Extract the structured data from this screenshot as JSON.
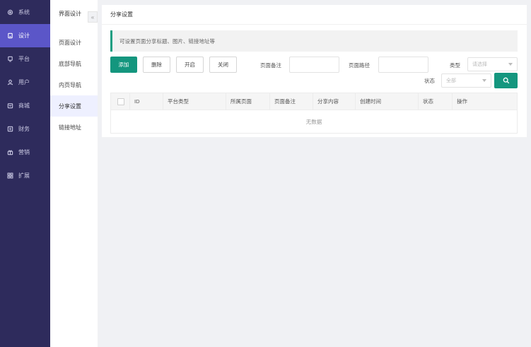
{
  "sidebar": {
    "items": [
      {
        "label": "系统",
        "icon": "gear-icon"
      },
      {
        "label": "设计",
        "icon": "design-icon"
      },
      {
        "label": "平台",
        "icon": "monitor-icon"
      },
      {
        "label": "用户",
        "icon": "user-icon"
      },
      {
        "label": "商城",
        "icon": "store-icon"
      },
      {
        "label": "财务",
        "icon": "finance-icon"
      },
      {
        "label": "营销",
        "icon": "gift-icon"
      },
      {
        "label": "扩展",
        "icon": "grid-icon"
      }
    ],
    "active": "设计"
  },
  "subsidebar": {
    "title": "界面设计",
    "collapse_glyph": "«",
    "items": [
      "页面设计",
      "底部导航",
      "内页导航",
      "分享设置",
      "链接地址"
    ],
    "active": "分享设置"
  },
  "main": {
    "title": "分享设置",
    "notice": "可设置页面分享标题、图片、链接地址等",
    "buttons": {
      "add": "添加",
      "delete": "删除",
      "enable": "开启",
      "disable": "关闭"
    },
    "filters": {
      "page_note_label": "页面备注",
      "page_path_label": "页面路径",
      "type_label": "类型",
      "type_placeholder": "请选择",
      "status_label": "状态",
      "status_value": "全部"
    },
    "table": {
      "columns": [
        "ID",
        "平台类型",
        "所属页面",
        "页面备注",
        "分享内容",
        "创建时间",
        "状态",
        "操作"
      ],
      "empty_text": "无数据"
    }
  },
  "colors": {
    "sidebar_bg": "#2e2b5c",
    "sidebar_active": "#5b56c8",
    "accent": "#14967e"
  }
}
